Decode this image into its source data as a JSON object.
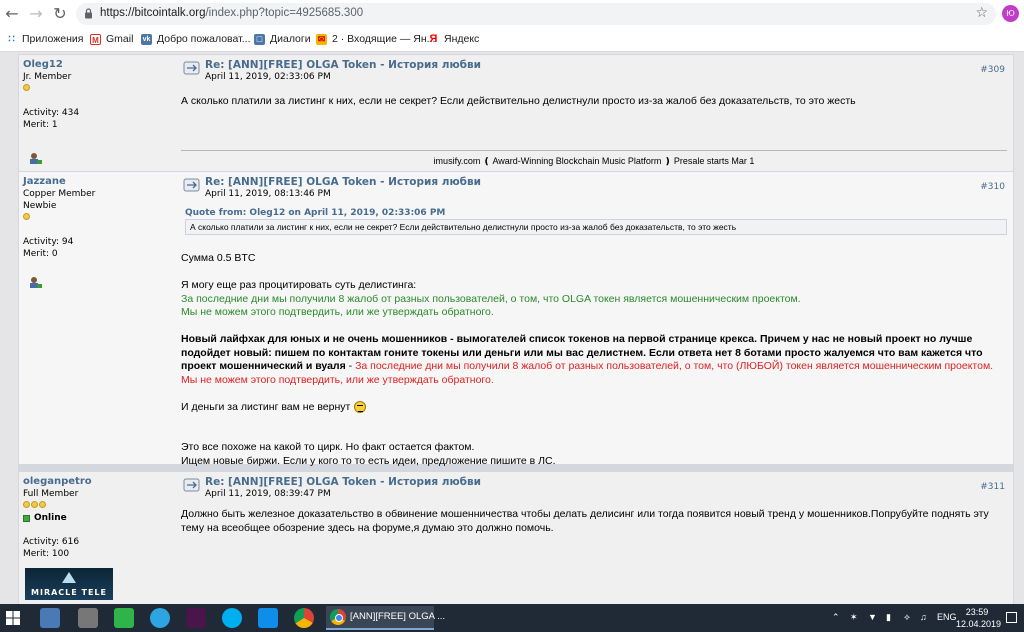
{
  "browser": {
    "url_host": "https://bitcointalk.org",
    "url_path": "/index.php?topic=4925685.300",
    "avatar_letter": "Ю",
    "bookmarks": [
      {
        "label": "Приложения",
        "icon": "apps-grid-icon"
      },
      {
        "label": "Gmail",
        "icon": "gmail-icon"
      },
      {
        "label": "Добро пожаловат...",
        "icon": "vk-icon"
      },
      {
        "label": "Диалоги",
        "icon": "dialogs-icon"
      },
      {
        "label": "2 · Входящие — Ян...",
        "icon": "mail-icon"
      },
      {
        "label": "Яндекс",
        "icon": "yandex-icon"
      }
    ]
  },
  "posts": [
    {
      "user": "Oleg12",
      "rank": "Jr. Member",
      "activity": "Activity: 434",
      "merit": "Merit: 1",
      "title": "Re: [ANN][FREE] OLGA Token - История любви",
      "date": "April 11, 2019, 02:33:06 PM",
      "num": "#309",
      "body": "А сколько платили за листинг к них, если не секрет? Если действительно делистнули просто из-за жалоб без доказательств, то это жесть",
      "ad": "imusify.com  ❪ Award-Winning Blockchain Music Platform  ❫  Presale starts Mar 1"
    },
    {
      "user": "Jazzane",
      "rank": "Copper Member",
      "rank2": "Newbie",
      "activity": "Activity: 94",
      "merit": "Merit: 0",
      "title": "Re: [ANN][FREE] OLGA Token - История любви",
      "date": "April 11, 2019, 08:13:46 PM",
      "num": "#310",
      "quote_head": "Quote from: Oleg12 on April 11, 2019, 02:33:06 PM",
      "quote": "А сколько платили за листинг к них, если не секрет? Если действительно делистнули просто из-за жалоб без доказательств, то это жесть",
      "l1": "Сумма 0.5 BTC",
      "l2": "Я могу еще раз процитировать суть делистинга:",
      "l3": "За последние дни мы получили 8 жалоб от разных пользователей, о том, что OLGA токен является мошенническим проектом.",
      "l4": "Мы не можем этого подтвердить, или же утверждать обратного.",
      "l5a": "Новый лайфхак для юных и не очень мошенников - вымогателей список токенов на первой странице крекса. Причем у нас не новый проект но лучше подойдет новый: пишем по контактам гоните токены или деньги или мы вас делистнем. Если ответа нет 8 ботами просто жалуемся что вам кажется что проект мошеннический и вуаля",
      "l5b": " - ",
      "l5c": "За последние дни мы получили 8 жалоб от разных пользователей, о том, что (ЛЮБОЙ) токен является мошенническим проектом.",
      "l6": "Мы не можем этого подтвердить, или же утверждать обратного.",
      "l7": "И деньги за листинг вам не вернут",
      "l8": "Это все похоже на какой то цирк. Но факт остается фактом.",
      "l9": "Ищем новые биржи. Если у кого то то есть идеи, предложение пишите в ЛС."
    },
    {
      "user": "oleganpetro",
      "rank": "Full Member",
      "status": "Online",
      "activity": "Activity: 616",
      "merit": "Merit: 100",
      "title": "Re: [ANN][FREE] OLGA Token - История любви",
      "date": "April 11, 2019, 08:39:47 PM",
      "num": "#311",
      "body": "Должно быть железное доказательство в обвинение мошенничества чтобы делать делисинг или тогда появится новый тренд у мошенников.Попрубуйте поднять эту тему на всеобщее обозрение здесь на форуме,я думаю это должно помочь.",
      "signature": "MIRACLE TELE"
    }
  ],
  "taskbar": {
    "window_title": "[ANN][FREE] OLGA ...",
    "lang": "ENG",
    "time": "23:59",
    "date": "12.04.2019"
  }
}
